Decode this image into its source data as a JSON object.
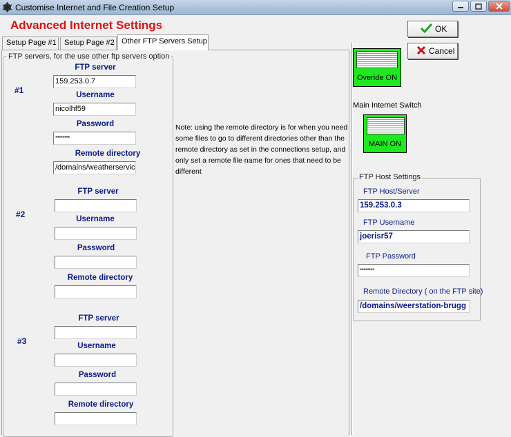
{
  "window": {
    "title": "Customise Internet and File Creation Setup"
  },
  "heading": "Advanced Internet Settings",
  "tabs": [
    {
      "label": "Setup Page #1"
    },
    {
      "label": "Setup Page #2"
    },
    {
      "label": "Other FTP Servers Setup"
    }
  ],
  "ftp_group": {
    "legend": "FTP servers, for the use other ftp servers option",
    "labels": {
      "server": "FTP server",
      "username": "Username",
      "password": "Password",
      "remote": "Remote directory"
    },
    "servers": [
      {
        "num": "#1",
        "server": "159.253.0.7",
        "username": "nicolhf59",
        "password": "********",
        "remote": "/domains/weatherservic"
      },
      {
        "num": "#2",
        "server": "",
        "username": "",
        "password": "",
        "remote": ""
      },
      {
        "num": "#3",
        "server": "",
        "username": "",
        "password": "",
        "remote": ""
      }
    ]
  },
  "note": "Note: using the remote directory is for when you need some files to go to different directories other than the remote directory as set in the connections setup, and only set a remote file name for ones that need to be different",
  "buttons": {
    "ok": "OK",
    "cancel": "Cancel"
  },
  "override_switch": {
    "label": "Overide ON"
  },
  "main_switch": {
    "caption": "Main Internet Switch",
    "label": "MAIN ON"
  },
  "host_group": {
    "legend": "FTP Host Settings",
    "host_label": "FTP Host/Server",
    "host_value": "159.253.0.3",
    "user_label": "FTP Username",
    "user_value": "joerisr57",
    "pass_label": "FTP Password",
    "pass_value": "********",
    "remote_label": "Remote Directory ( on the FTP site)",
    "remote_value": "/domains/weerstation-brugg"
  },
  "colors": {
    "heading": "#e01010",
    "label_blue": "#0a1a8c",
    "switch_green": "#1ee81e",
    "ok_check": "#2a9d2a",
    "cancel_x": "#c81414"
  },
  "icons": [
    "app-icon",
    "minimize-icon",
    "maximize-icon",
    "close-icon",
    "checkmark-icon",
    "x-icon"
  ]
}
